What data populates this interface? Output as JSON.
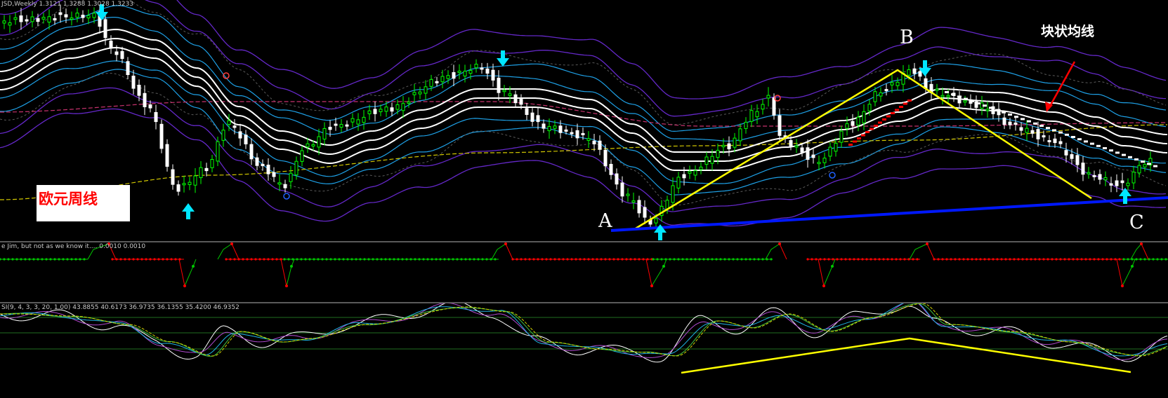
{
  "main_pane": {
    "caption": "JSD,Weekly  1.3121 1.3288 1.3028 1.3233",
    "label_euro_weekly": "欧元周线",
    "label_block_ma": "块状均线",
    "point_a": "A",
    "point_b": "B",
    "point_c": "C"
  },
  "indicator1": {
    "caption": "e Jim, but not as we know it....  0.0010 0.0010"
  },
  "indicator2": {
    "caption": "SI(9, 4, 3, 3, 20, 1.00) 43.8855 40.6173 36.9735 36.1355 35.4200 46.9352"
  },
  "colors": {
    "bull_candle": "#00ff00",
    "bear_candle": "#ffffff",
    "ma_white": "#ffffff",
    "band_blue": "#1ea0e6",
    "band_purple": "#6428c8",
    "trend_yellow": "#ffff00",
    "support_blue": "#0018ff",
    "signal_cyan": "#00e6ff",
    "dot_green": "#00c800",
    "dot_red": "#ff0000"
  },
  "icons": {
    "down_arrow": "cyan-down-arrow-icon",
    "up_arrow": "cyan-up-arrow-icon",
    "fractal": "fractal-marker-icon"
  }
}
